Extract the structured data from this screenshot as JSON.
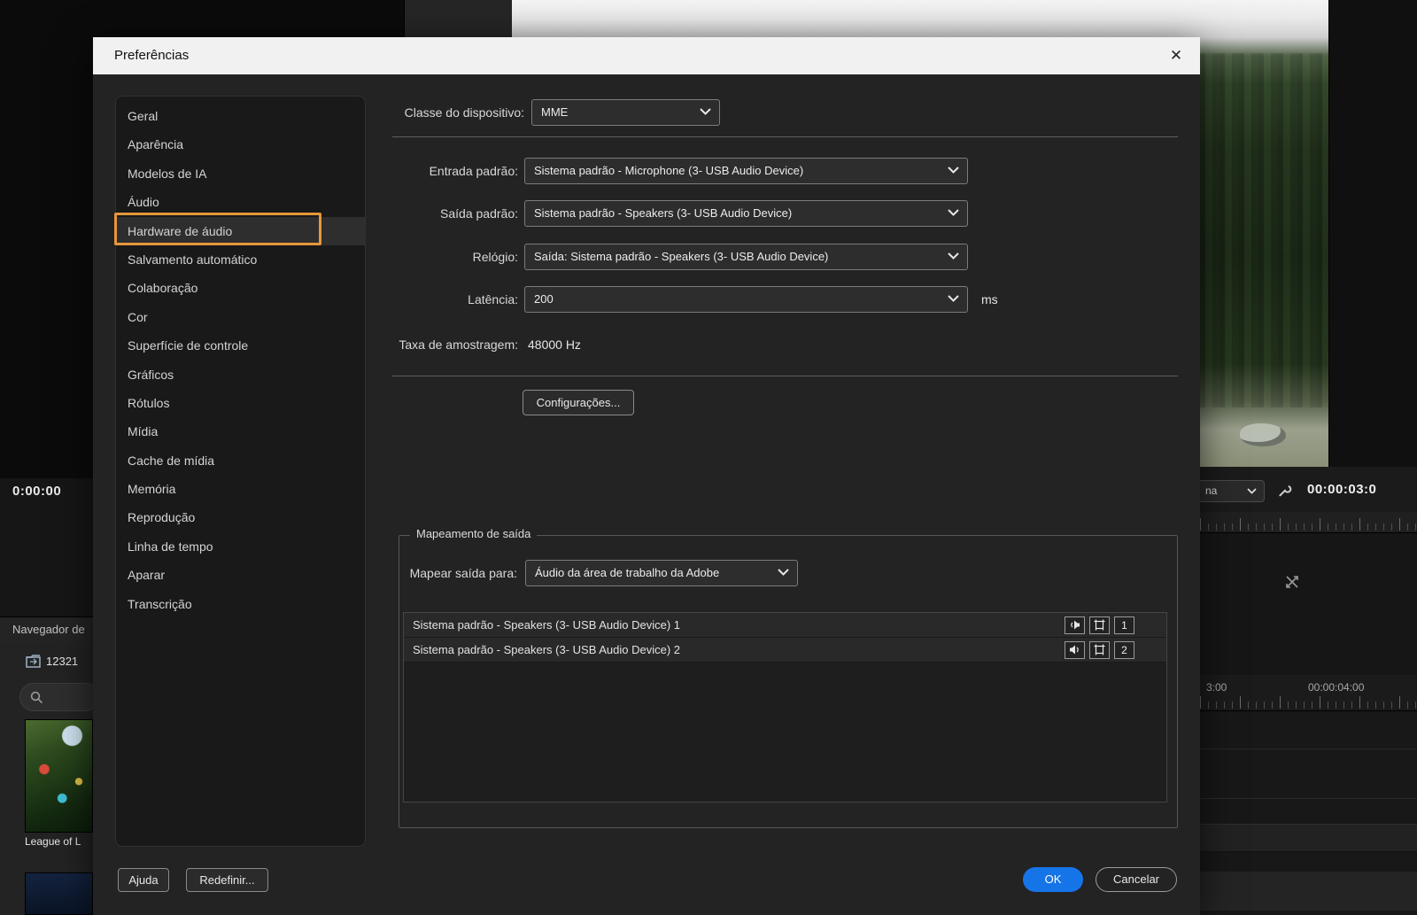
{
  "dialog": {
    "title": "Preferências",
    "close_glyph": "✕",
    "sidebar": {
      "items": [
        "Geral",
        "Aparência",
        "Modelos de IA",
        "Áudio",
        "Hardware de áudio",
        "Salvamento automático",
        "Colaboração",
        "Cor",
        "Superfície de controle",
        "Gráficos",
        "Rótulos",
        "Mídia",
        "Cache de mídia",
        "Memória",
        "Reprodução",
        "Linha de tempo",
        "Aparar",
        "Transcrição"
      ],
      "selected_item": "Hardware de áudio",
      "highlight_color": "#E6973B"
    },
    "device_class": {
      "label": "Classe do dispositivo:",
      "value": "MME"
    },
    "rows": [
      {
        "label": "Entrada padrão:",
        "value": "Sistema padrão - Microphone (3- USB Audio Device)"
      },
      {
        "label": "Saída padrão:",
        "value": "Sistema padrão - Speakers (3- USB Audio Device)"
      },
      {
        "label": "Relógio:",
        "value": "Saída: Sistema padrão - Speakers (3- USB Audio Device)"
      },
      {
        "label": "Latência:",
        "value": "200",
        "suffix": "ms"
      }
    ],
    "sample_rate": {
      "label": "Taxa de amostragem:",
      "value": "48000 Hz"
    },
    "settings_button_label": "Configurações...",
    "output_mapping": {
      "group_label": "Mapeamento de saída",
      "map_label": "Mapear saída para:",
      "map_value": "Áudio da área de trabalho da Adobe",
      "rows": [
        {
          "name": "Sistema padrão - Speakers (3- USB Audio Device) 1",
          "channel": "1"
        },
        {
          "name": "Sistema padrão - Speakers (3- USB Audio Device) 2",
          "channel": "2"
        }
      ]
    },
    "footer": {
      "help": "Ajuda",
      "reset": "Redefinir...",
      "ok": "OK",
      "cancel": "Cancelar"
    }
  },
  "background": {
    "left_panel": {
      "timecode": "0:00:00",
      "panel_title": "Navegador de",
      "bin_name": "12321",
      "clip_caption": "League of L"
    },
    "timeline": {
      "dropdown_fragment": "na",
      "timecode": "00:00:03:0",
      "ruler_label_left": "3:00",
      "ruler_label_right": "00:00:04:00"
    }
  }
}
